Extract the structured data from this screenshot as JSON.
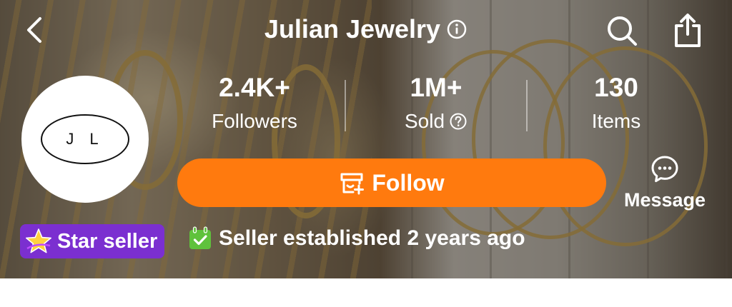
{
  "header": {
    "title": "Julian Jewelry",
    "back_icon": "chevron-left-icon",
    "info_icon": "info-icon",
    "search_icon": "search-icon",
    "share_icon": "share-icon"
  },
  "store": {
    "avatar_initials": "J L",
    "stats": [
      {
        "value": "2.4K+",
        "label": "Followers"
      },
      {
        "value": "1M+",
        "label": "Sold",
        "icon": "question-circle-icon"
      },
      {
        "value": "130",
        "label": "Items"
      }
    ]
  },
  "actions": {
    "follow_label": "Follow",
    "follow_icon": "store-add-icon",
    "message_label": "Message",
    "message_icon": "chat-bubble-icon"
  },
  "badges": {
    "star_seller_label": "Star seller",
    "star_icon": "star-icon",
    "established_label": "Seller established 2 years ago",
    "calendar_icon": "calendar-check-icon"
  },
  "colors": {
    "accent": "#ff7a0e",
    "star_badge": "#7b2fd0",
    "calendar_green": "#5fc23c"
  }
}
